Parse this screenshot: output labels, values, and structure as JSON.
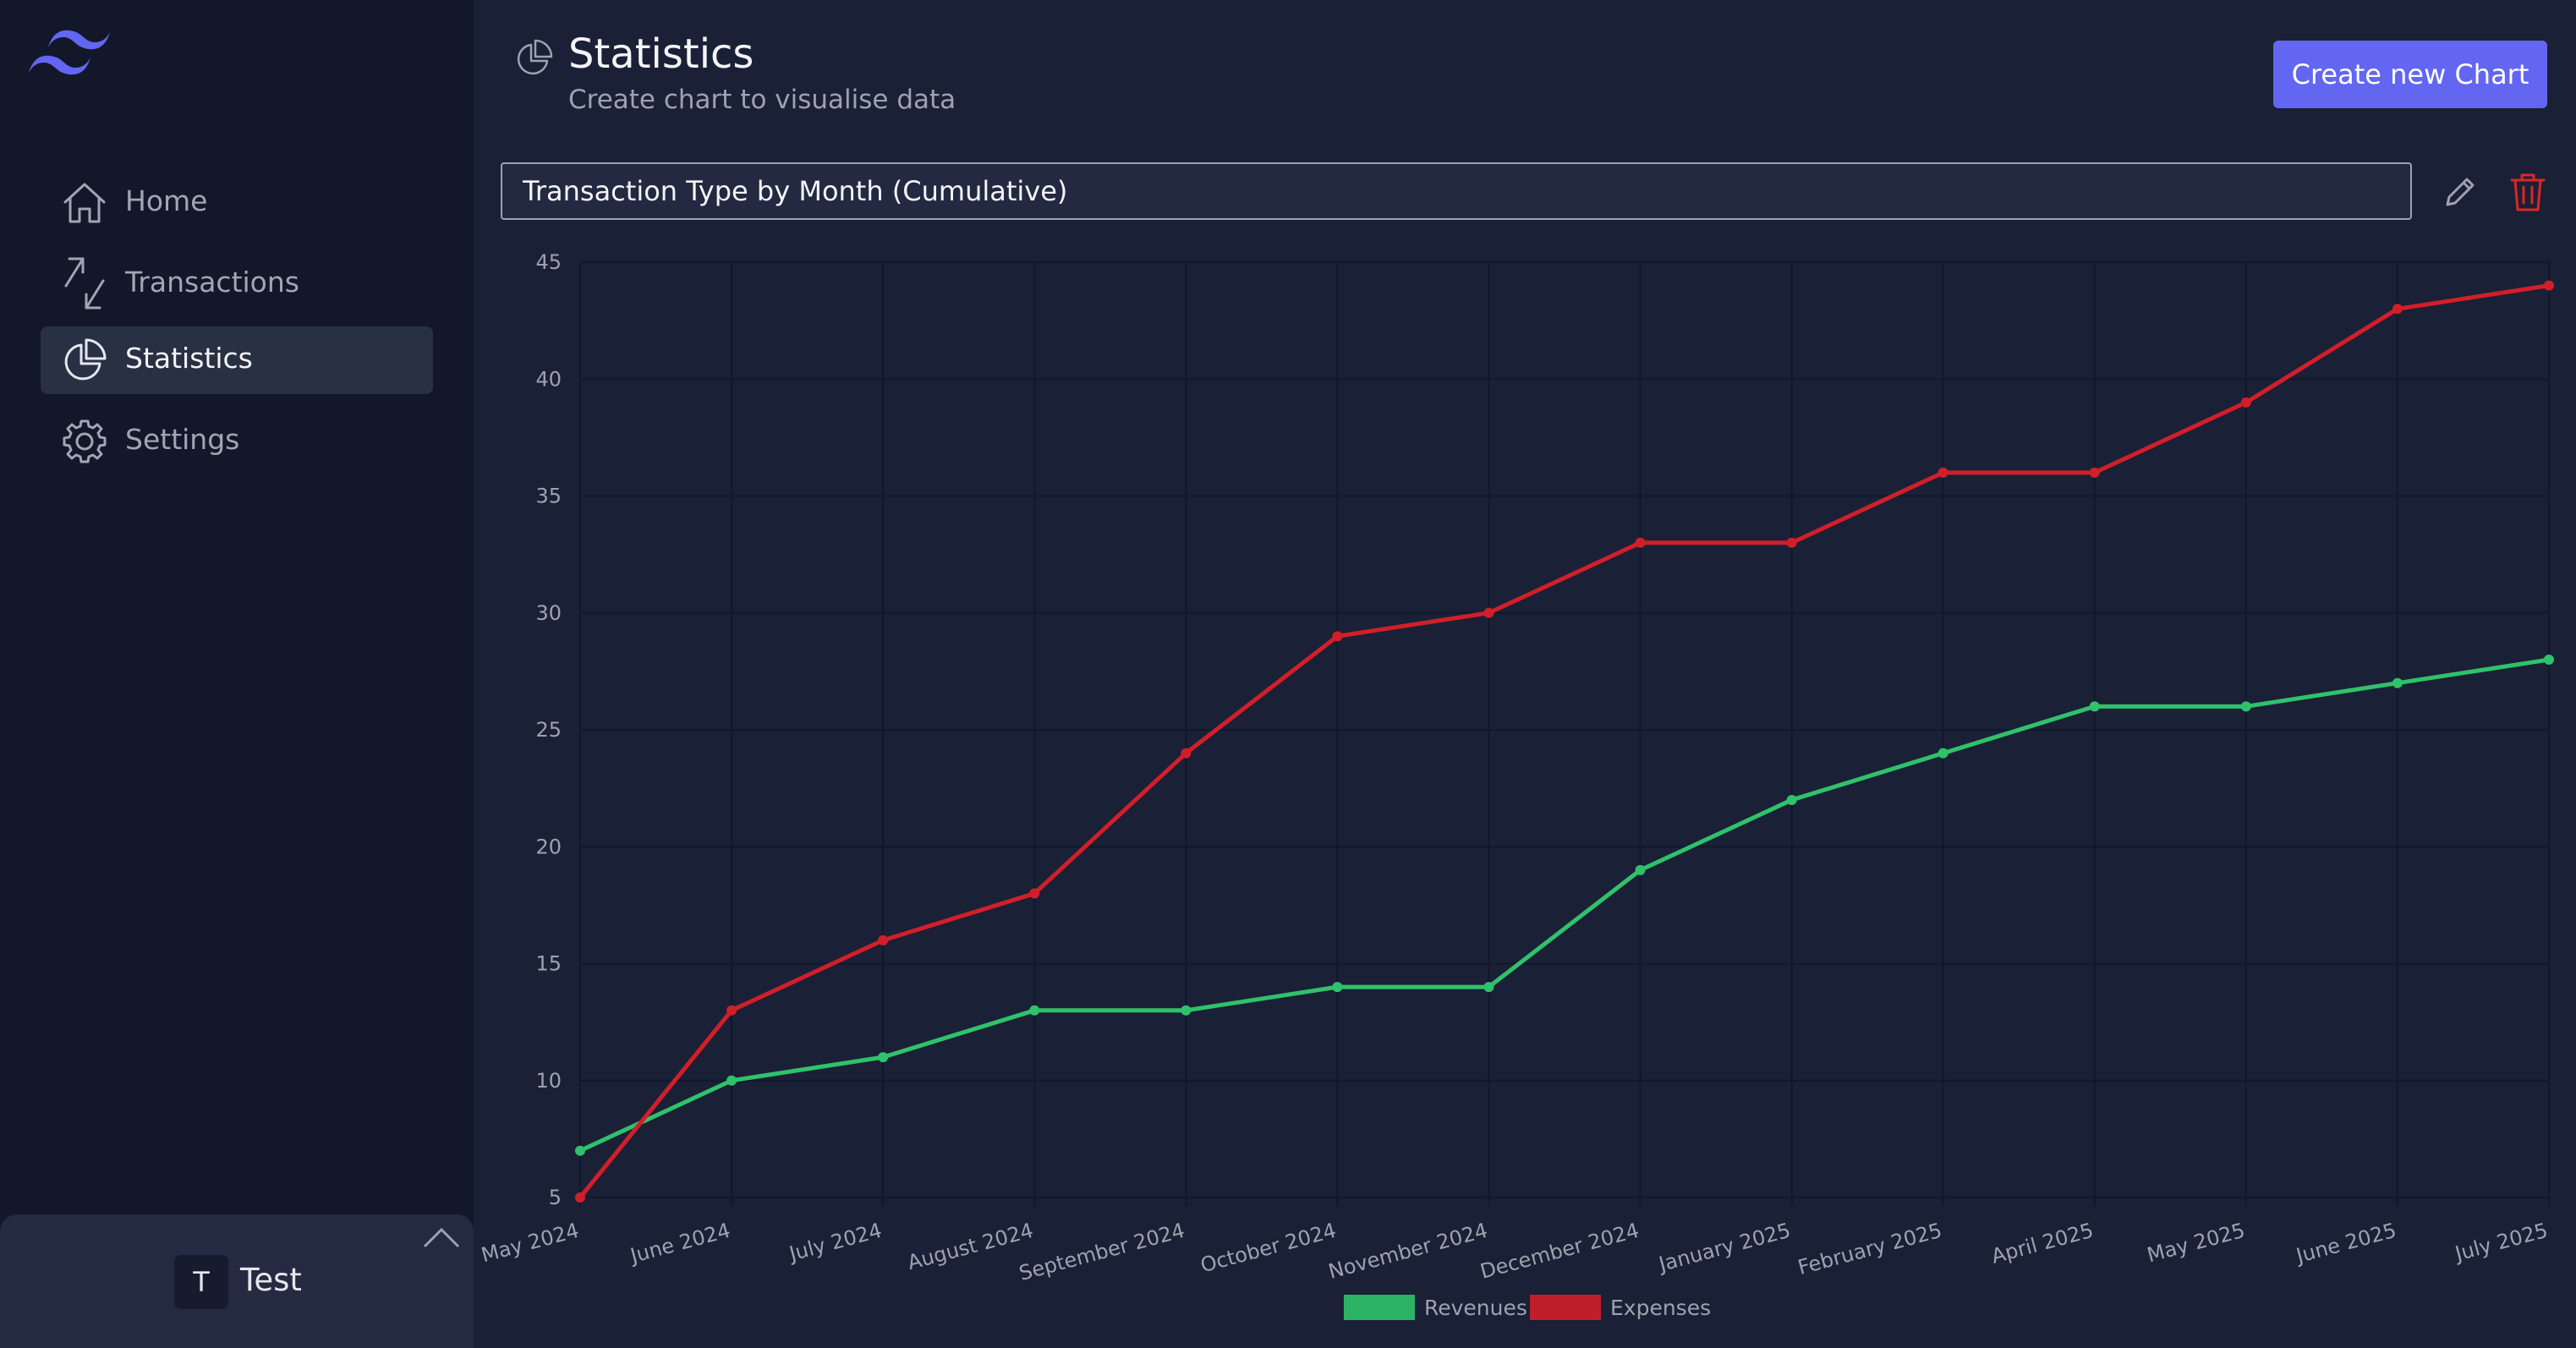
{
  "sidebar": {
    "items": [
      {
        "label": "Home",
        "icon": "home-icon",
        "active": false
      },
      {
        "label": "Transactions",
        "icon": "arrows-icon",
        "active": false
      },
      {
        "label": "Statistics",
        "icon": "pie-chart-icon",
        "active": true
      },
      {
        "label": "Settings",
        "icon": "gear-icon",
        "active": false
      }
    ],
    "user": {
      "initial": "T",
      "name": "Test"
    }
  },
  "header": {
    "title": "Statistics",
    "subtitle": "Create chart to visualise data",
    "create_button_label": "Create new Chart"
  },
  "chart_editor": {
    "title_value": "Transaction Type by Month (Cumulative)"
  },
  "colors": {
    "accent": "#6366f1",
    "revenues": "#22c55e",
    "expenses": "#dc2626",
    "delete": "#dc2626"
  },
  "chart_data": {
    "type": "line",
    "categories": [
      "May 2024",
      "June 2024",
      "July 2024",
      "August 2024",
      "September 2024",
      "October 2024",
      "November 2024",
      "December 2024",
      "January 2025",
      "February 2025",
      "April 2025",
      "May 2025",
      "June 2025",
      "July 2025"
    ],
    "series": [
      {
        "name": "Revenues",
        "color": "#2fc26b",
        "values": [
          7,
          10,
          11,
          13,
          13,
          14,
          14,
          19,
          22,
          24,
          26,
          26,
          27,
          28
        ]
      },
      {
        "name": "Expenses",
        "color": "#d11f2a",
        "values": [
          5,
          13,
          16,
          18,
          24,
          29,
          30,
          33,
          33,
          36,
          36,
          39,
          43,
          44
        ]
      }
    ],
    "ylim": [
      5,
      45
    ],
    "yticks": [
      5,
      10,
      15,
      20,
      25,
      30,
      35,
      40,
      45
    ],
    "grid": true,
    "legend": "bottom"
  }
}
